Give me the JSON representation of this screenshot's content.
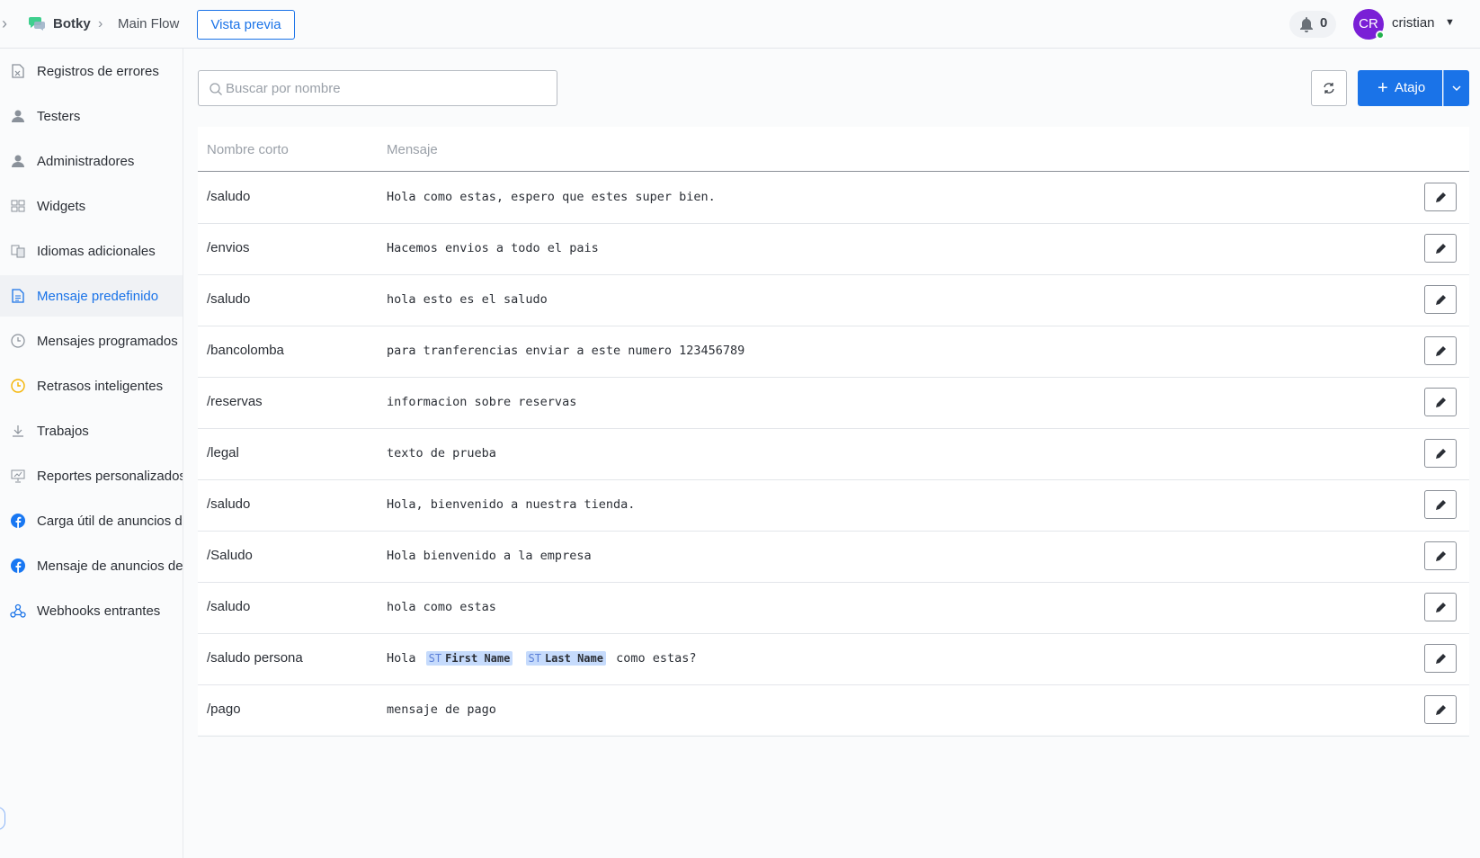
{
  "header": {
    "bot_name": "Botky",
    "flow_name": "Main Flow",
    "preview_label": "Vista previa",
    "notifications_count": "0",
    "avatar_initials": "CR",
    "username": "cristian"
  },
  "sidebar": {
    "items": [
      {
        "label": "Registros de errores",
        "icon": "error-log-icon"
      },
      {
        "label": "Testers",
        "icon": "user-icon"
      },
      {
        "label": "Administradores",
        "icon": "admin-icon"
      },
      {
        "label": "Widgets",
        "icon": "widgets-icon"
      },
      {
        "label": "Idiomas adicionales",
        "icon": "language-icon"
      },
      {
        "label": "Mensaje predefinido",
        "icon": "document-icon",
        "active": true
      },
      {
        "label": "Mensajes programados",
        "icon": "clock-icon"
      },
      {
        "label": "Retrasos inteligentes",
        "icon": "smart-delay-icon"
      },
      {
        "label": "Trabajos",
        "icon": "download-icon"
      },
      {
        "label": "Reportes personalizados",
        "icon": "report-icon"
      },
      {
        "label": "Carga útil de anuncios de",
        "icon": "facebook-icon"
      },
      {
        "label": "Mensaje de anuncios de",
        "icon": "facebook-icon"
      },
      {
        "label": "Webhooks entrantes",
        "icon": "webhook-icon"
      }
    ]
  },
  "toolbar": {
    "search_placeholder": "Buscar por nombre",
    "add_label": "Atajo"
  },
  "table": {
    "headers": {
      "name": "Nombre corto",
      "message": "Mensaje"
    },
    "rows": [
      {
        "name": "/saludo",
        "message": "Hola como estas, espero que estes super bien."
      },
      {
        "name": "/envios",
        "message": "Hacemos envios a todo el pais"
      },
      {
        "name": "/saludo",
        "message": "hola esto es el saludo"
      },
      {
        "name": "/bancolomba",
        "message": "para tranferencias enviar a este numero 123456789"
      },
      {
        "name": "/reservas",
        "message": "informacion sobre reservas"
      },
      {
        "name": "/legal",
        "message": "texto de prueba"
      },
      {
        "name": "/saludo",
        "message": "Hola, bienvenido a nuestra tienda."
      },
      {
        "name": "/Saludo",
        "message": "Hola bienvenido a la empresa"
      },
      {
        "name": "/saludo",
        "message": "hola como estas"
      },
      {
        "name": "/saludo persona",
        "message_prefix": "Hola",
        "chip_icon": "ST",
        "chip_first": "First Name",
        "chip_last": "Last Name",
        "message_suffix": "como estas?"
      },
      {
        "name": "/pago",
        "message": "mensaje de pago"
      }
    ]
  },
  "colors": {
    "accent": "#1a73e8",
    "avatar": "#7a1fd6",
    "online": "#22b14c",
    "chip": "#c6dbfc"
  }
}
